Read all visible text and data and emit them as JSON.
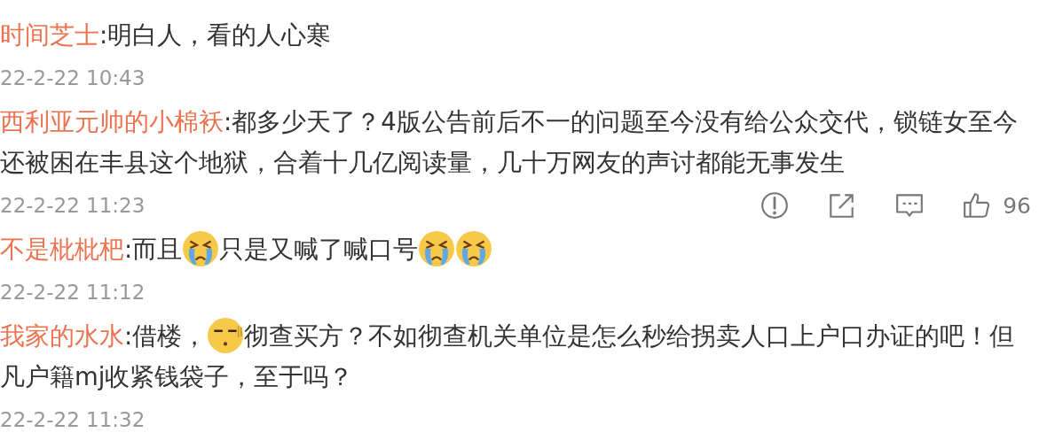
{
  "comments": [
    {
      "author": "时间芝士",
      "segments": [
        {
          "kind": "text",
          "text": ":明白人，看的人心寒"
        }
      ],
      "time": "22-2-22 10:43"
    },
    {
      "author": "西利亚元帅的小棉袄",
      "segments": [
        {
          "kind": "text",
          "text": ":都多少天了？4版公告前后不一的问题至今没有给公众交代，锁链女至今还被困在丰县这个地狱，合着十几亿阅读量，几十万网友的声讨都能无事发生"
        }
      ],
      "time": "22-2-22 11:23",
      "actions": {
        "likes": "96"
      }
    },
    {
      "author": "不是枇枇杷",
      "segments": [
        {
          "kind": "text",
          "text": ":而且"
        },
        {
          "kind": "crying"
        },
        {
          "kind": "text",
          "text": "只是又喊了喊口号"
        },
        {
          "kind": "crying"
        },
        {
          "kind": "crying"
        }
      ],
      "time": "22-2-22 11:12"
    },
    {
      "author": "我家的水水",
      "segments": [
        {
          "kind": "text",
          "text": ":借楼，"
        },
        {
          "kind": "silent"
        },
        {
          "kind": "text",
          "text": "彻查买方？不如彻查机关单位是怎么秒给拐卖人口上户口办证的吧！但凡户籍mj收紧钱袋子，至于吗？"
        }
      ],
      "time": "22-2-22 11:32"
    }
  ]
}
